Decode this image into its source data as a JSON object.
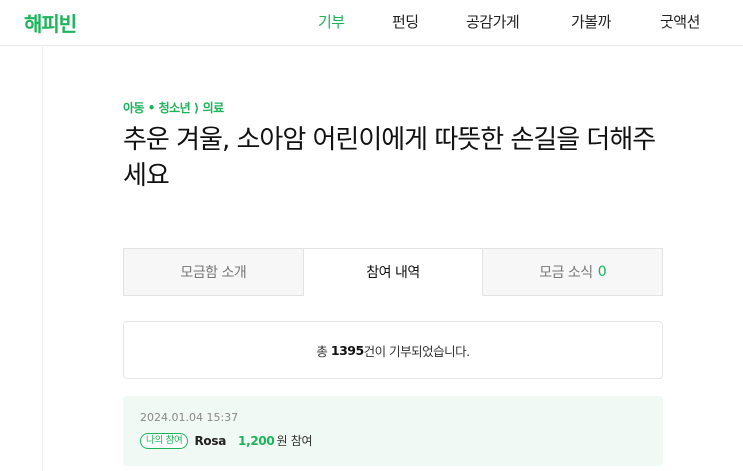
{
  "header": {
    "logo": "해피빈",
    "menu": [
      "기부",
      "펀딩",
      "공감가게",
      "가볼까",
      "굿액션"
    ]
  },
  "campaign": {
    "category": "아동 • 청소년 ⟩ 의료",
    "title": "추운 겨울, 소아암 어린이에게 따뜻한 손길을 더해주세요"
  },
  "tabs": {
    "intro": "모금함 소개",
    "history": "참여 내역",
    "news": "모금 소식",
    "news_count": "0"
  },
  "summary": {
    "prefix": "총 ",
    "count": "1395",
    "suffix": "건이 기부되었습니다."
  },
  "donations": [
    {
      "date": "2024.01.04 15:37",
      "badge": "나의 참여",
      "name": "Rosa",
      "amount": "1,200",
      "amount_suffix": "원 참여"
    }
  ],
  "colors": {
    "accent": "#1cb35b",
    "row_bg": "#f1f9f4"
  }
}
